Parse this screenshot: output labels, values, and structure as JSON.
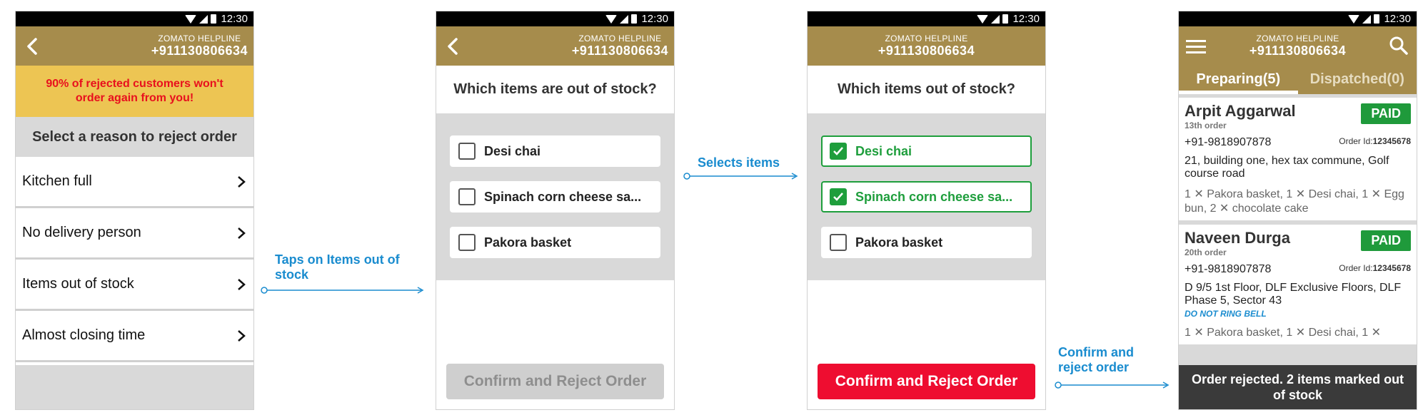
{
  "status_bar": {
    "time": "12:30"
  },
  "helpline": {
    "label": "ZOMATO HELPLINE",
    "number": "+911130806634"
  },
  "screen1": {
    "warning": "90% of rejected customers won't order again from you!",
    "title": "Select a reason to reject order",
    "reasons": [
      "Kitchen full",
      "No delivery person",
      "Items out of stock",
      "Almost closing time"
    ]
  },
  "screen2": {
    "question": "Which items are out of stock?",
    "items": [
      "Desi chai",
      "Spinach corn cheese sa...",
      "Pakora basket"
    ],
    "confirm": "Confirm and Reject Order"
  },
  "screen3": {
    "question": "Which items out of stock?",
    "items": [
      "Desi chai",
      "Spinach corn cheese sa...",
      "Pakora basket"
    ],
    "checked": [
      true,
      true,
      false
    ],
    "confirm": "Confirm and Reject Order"
  },
  "screen4": {
    "tabs": [
      "Preparing(5)",
      "Dispatched(0)"
    ],
    "orders": [
      {
        "name": "Arpit Aggarwal",
        "sub": "13th order",
        "badge": "PAID",
        "phone": "+91-9818907878",
        "order_id_label": "Order Id:",
        "order_id": "12345678",
        "address": "21, building one, hex tax commune, Golf course road",
        "note": "",
        "items": "1 ✕ Pakora basket, 1 ✕ Desi chai, 1 ✕ Egg bun, 2 ✕ chocolate cake"
      },
      {
        "name": "Naveen Durga",
        "sub": "20th order",
        "badge": "PAID",
        "phone": "+91-9818907878",
        "order_id_label": "Order Id:",
        "order_id": "12345678",
        "address": "D 9/5 1st Floor, DLF Exclusive Floors, DLF Phase 5, Sector 43",
        "note": "DO NOT RING BELL",
        "items": "1 ✕ Pakora basket, 1 ✕ Desi chai, 1 ✕"
      }
    ],
    "toast": "Order rejected. 2 items marked out of stock"
  },
  "annotations": {
    "a1": "Taps on Items out of stock",
    "a2": "Selects items",
    "a3": "Confirm and reject order"
  },
  "colors": {
    "header": "#a68c4c",
    "warning_bg": "#edc553",
    "warning_text": "#e8101e",
    "accent_green": "#1e9e3c",
    "reject_red": "#ee0d30",
    "annotation_blue": "#1a8ccf"
  }
}
